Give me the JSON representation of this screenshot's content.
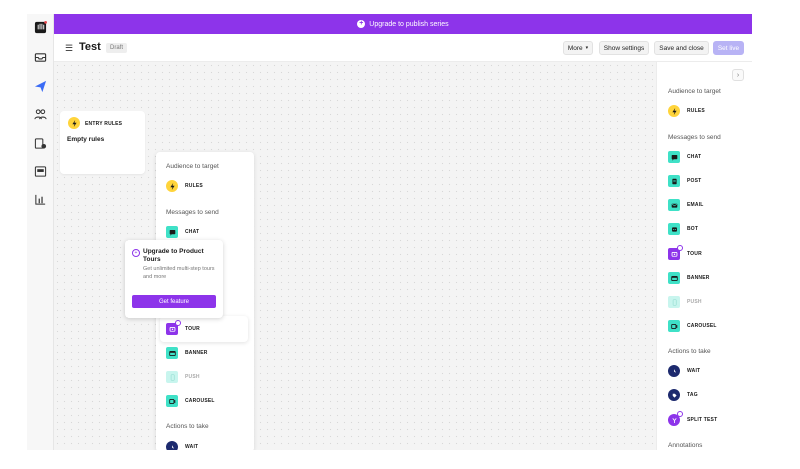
{
  "banner": {
    "text": "Upgrade to publish series"
  },
  "header": {
    "title": "Test",
    "status": "Draft",
    "more_label": "More",
    "show_settings_label": "Show settings",
    "save_close_label": "Save and close",
    "go_live_label": "Set live"
  },
  "canvas": {
    "entry_card": {
      "label": "ENTRY RULES",
      "value": "Empty rules"
    }
  },
  "panel": {
    "audience_heading": "Audience to target",
    "rules_label": "RULES",
    "messages_heading": "Messages to send",
    "chat_label": "CHAT",
    "tour_label": "TOUR",
    "banner_label": "BANNER",
    "push_label": "PUSH",
    "carousel_label": "CAROUSEL",
    "actions_heading": "Actions to take",
    "wait_label": "WAIT"
  },
  "tooltip": {
    "title": "Upgrade to Product Tours",
    "description": "Get unlimited multi-step tours and more",
    "button_label": "Get feature"
  },
  "sidebar": {
    "audience_heading": "Audience to target",
    "rules_label": "RULES",
    "messages_heading": "Messages to send",
    "chat_label": "CHAT",
    "post_label": "POST",
    "email_label": "EMAIL",
    "bot_label": "BOT",
    "tour_label": "TOUR",
    "banner_label": "BANNER",
    "push_label": "PUSH",
    "carousel_label": "CAROUSEL",
    "actions_heading": "Actions to take",
    "wait_label": "WAIT",
    "tag_label": "TAG",
    "split_test_label": "SPLIT TEST",
    "annotations_heading": "Annotations"
  },
  "colors": {
    "accent": "#8d34ea",
    "teal": "#3fe1c7",
    "navy": "#1d2a6e",
    "rules": "#ffd43b"
  }
}
